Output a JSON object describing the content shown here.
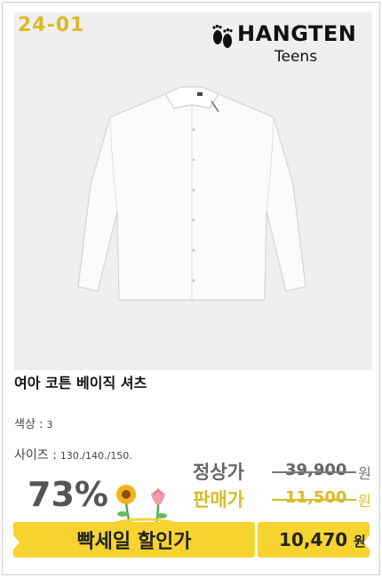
{
  "product": {
    "code": "24-01",
    "brand_name": "HANGTEN",
    "brand_sub": "Teens",
    "title": "여아 코튼 베이직 셔츠",
    "color_label": "색상 :",
    "color_value": "3",
    "size_label": "사이즈 :",
    "size_value": "130./140./150.",
    "discount": "73%",
    "regular_price_label": "정상가",
    "regular_price": "39,900",
    "sale_price_label": "판매가",
    "sale_price": "11,500",
    "currency": "원",
    "promo_label": "빡세일 할인가",
    "promo_price": "10,470",
    "promo_currency": "원"
  },
  "icons": {
    "brand": "footprints-logo-icon",
    "flowers": "flower-decoration-icon"
  },
  "colors": {
    "accent_yellow": "#f7d32f",
    "gold_text": "#d9bb2a",
    "photo_bg": "#efefef"
  }
}
